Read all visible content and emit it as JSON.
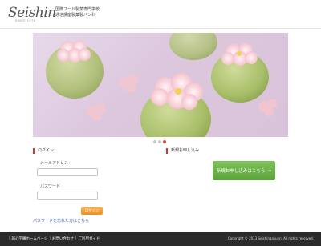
{
  "header": {
    "logo": "Seishin",
    "since": "SINCE 1976",
    "line1": "国際フード製菓専門学校",
    "line2": "通信講座製菓製パン科"
  },
  "carousel": {
    "slides": 3,
    "active_index": 2,
    "colors": {
      "active": "#d9503f",
      "inactive": "#c9c9c9"
    }
  },
  "login": {
    "heading": "ログイン",
    "email_label": "メールアドレス",
    "email_value": "",
    "password_label": "パスワード",
    "password_value": "",
    "submit_label": "ログイン",
    "forgot_link": "パスワードを忘れた方はこちら"
  },
  "signup": {
    "heading": "新規お申し込み",
    "button_label": "新規お申し込みはこちら",
    "button_icon": "arrow-right-icon"
  },
  "footer": {
    "links": [
      "誠心学園ホームページ",
      "お問い合わせ",
      "ご利用ガイド"
    ],
    "copyright": "Copyright © 2013 Seishingakuen. All rights reserved."
  },
  "colors": {
    "accent_red": "#d9302b",
    "login_orange": "#ec8f25",
    "signup_green": "#5aa33a",
    "link_blue": "#3a66b3",
    "footer_bg": "#2b2b2b"
  }
}
